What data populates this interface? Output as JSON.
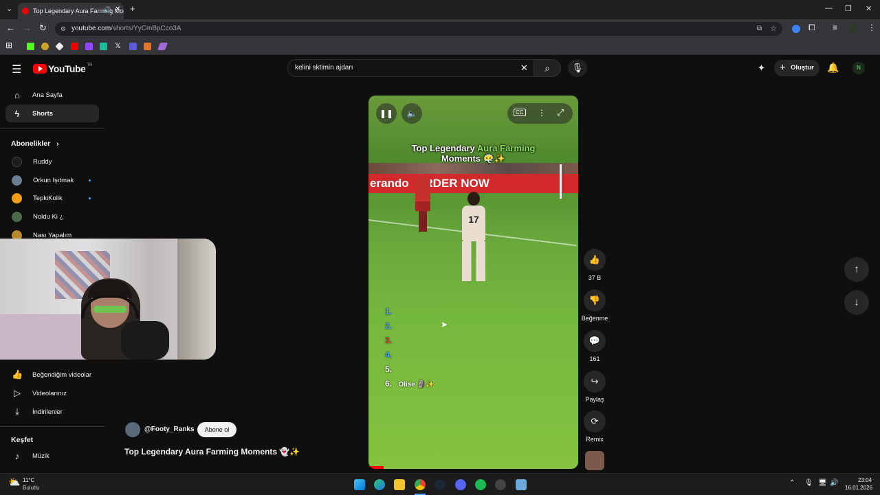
{
  "browser": {
    "tab_title": "Top Legendary Aura Farming Moments",
    "url_host": "youtube.com",
    "url_path": "/shorts/YyCmBpCco3A"
  },
  "youtube": {
    "logo_text": "YouTube",
    "region": "TR",
    "search_value": "kelini sktimin ajdarı",
    "create_label": "Oluştur"
  },
  "sidebar": {
    "main": [
      {
        "label": "Ana Sayfa",
        "icon": "home-icon"
      },
      {
        "label": "Shorts",
        "icon": "shorts-icon"
      }
    ],
    "subs_header": "Abonelikler",
    "subs": [
      {
        "label": "Ruddy",
        "color": "#2b2b2b",
        "dot": false
      },
      {
        "label": "Orkun Işıtmak",
        "color": "#6b7d92",
        "dot": true
      },
      {
        "label": "TepkiKolik",
        "color": "#f39c12",
        "dot": true
      },
      {
        "label": "Noldu Ki ¿",
        "color": "#4a6a4a",
        "dot": false
      },
      {
        "label": "Nası Yapalım",
        "color": "#b88a2a",
        "dot": false
      }
    ],
    "you": [
      {
        "label": "Beğendiğim videolar",
        "icon": "like-icon"
      },
      {
        "label": "Videolarınız",
        "icon": "video-icon"
      },
      {
        "label": "İndirilenler",
        "icon": "download-icon"
      }
    ],
    "explore_header": "Keşfet",
    "explore": [
      {
        "label": "Müzik",
        "icon": "music-icon"
      }
    ]
  },
  "short": {
    "channel": "@Footy_Ranks",
    "subscribe_label": "Abone ol",
    "title": "Top Legendary Aura Farming Moments 👻✨",
    "overlay_title_1": "Top Legendary",
    "overlay_title_1g": "Aura Farming",
    "overlay_title_2": "Moments 😶‍🌫️✨",
    "board_text": "erando  ORDER NOW",
    "jersey": "17",
    "ranks": [
      "1.",
      "2.",
      "3.",
      "4.",
      "5.",
      "6."
    ],
    "rank6_name": "Olise 🗿✨"
  },
  "actions": {
    "like_count": "37 B",
    "dislike_label": "Beğenme",
    "comments_count": "161",
    "share_label": "Paylaş",
    "remix_label": "Remix"
  },
  "taskbar": {
    "temp": "11°C",
    "weather": "Bulutlu",
    "time": "23:04",
    "date": "16.01.2026"
  }
}
